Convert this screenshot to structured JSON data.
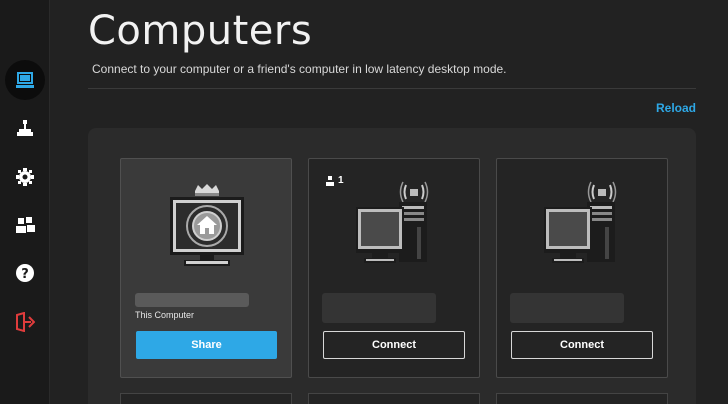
{
  "header": {
    "title": "Computers",
    "subtitle": "Connect to your computer or a friend's computer in low latency desktop mode.",
    "reload_label": "Reload"
  },
  "sidebar": {
    "items": [
      {
        "icon": "computer-icon",
        "active": true
      },
      {
        "icon": "joystick-icon",
        "active": false
      },
      {
        "icon": "gear-icon",
        "active": false
      },
      {
        "icon": "friends-icon",
        "active": false
      },
      {
        "icon": "help-icon",
        "active": false
      },
      {
        "icon": "logout-icon",
        "active": false
      }
    ]
  },
  "computers": [
    {
      "label": "This Computer",
      "action": "Share",
      "own": true
    },
    {
      "users": "1",
      "action": "Connect",
      "own": false
    },
    {
      "action": "Connect",
      "own": false
    }
  ],
  "colors": {
    "accent": "#2ea8e6",
    "background": "#222222",
    "panel": "#2b2b2b",
    "logout": "#e03c3c"
  }
}
